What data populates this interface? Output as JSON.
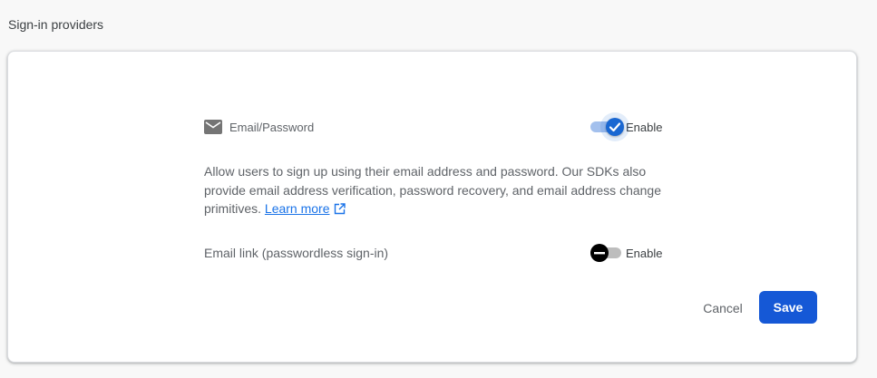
{
  "section": {
    "title": "Sign-in providers"
  },
  "providers": [
    {
      "icon": "mail-icon",
      "label": "Email/Password",
      "enabled": true,
      "toggle_label": "Enable"
    },
    {
      "label": "Email link (passwordless sign-in)",
      "enabled": false,
      "toggle_label": "Enable"
    }
  ],
  "description": {
    "text": "Allow users to sign up using their email address and password. Our SDKs also provide email address verification, password recovery, and email address change primitives.",
    "link_label": "Learn more",
    "link_icon": "open-in-new-icon"
  },
  "actions": {
    "cancel_label": "Cancel",
    "save_label": "Save"
  },
  "colors": {
    "accent": "#1967d2",
    "save_button": "#1558d6",
    "link": "#1a73e8"
  }
}
